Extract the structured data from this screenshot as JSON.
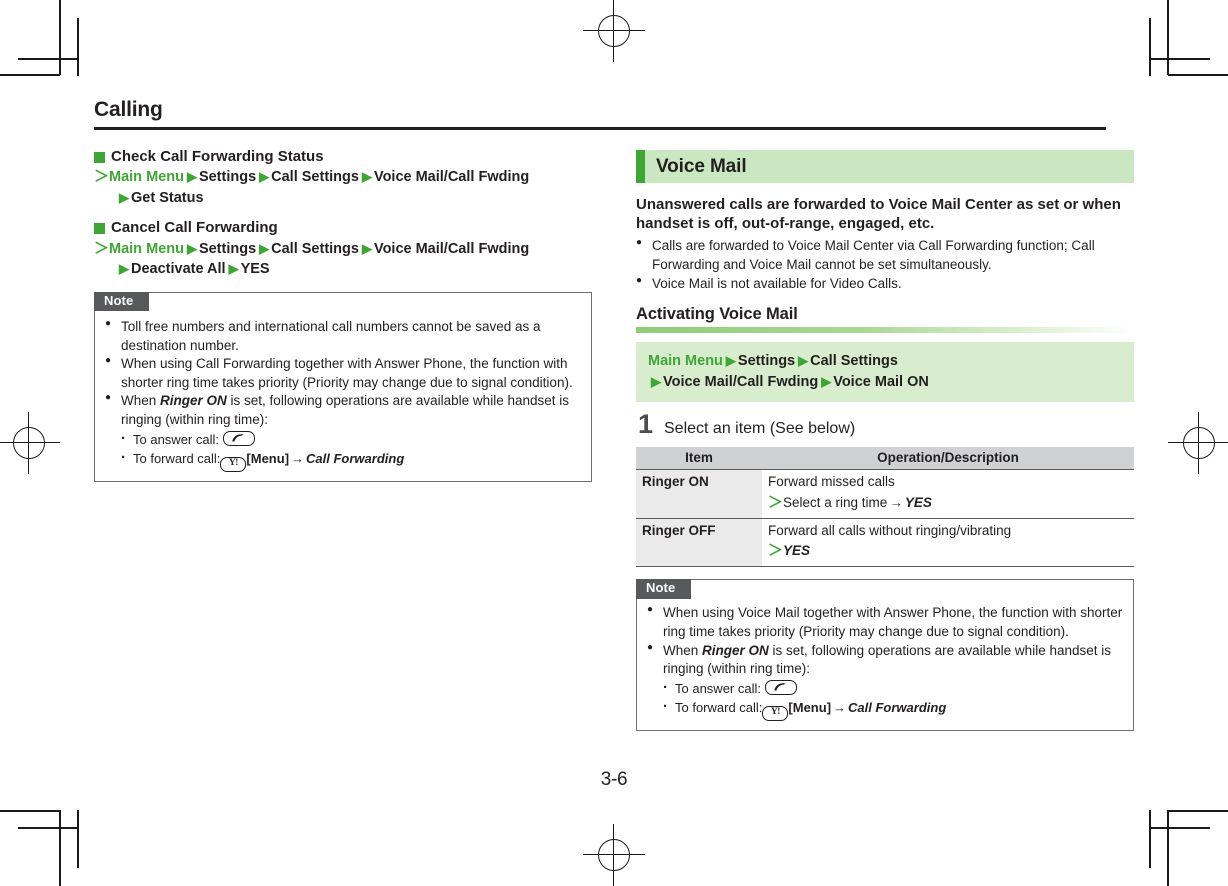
{
  "page": {
    "chapter_title": "Calling",
    "page_number": "3-6"
  },
  "left_column": {
    "sections": [
      {
        "heading": "Check Call Forwarding Status",
        "path_line1": [
          "Main Menu",
          "Settings",
          "Call Settings",
          "Voice Mail/Call Fwding"
        ],
        "path_line2": [
          "Get Status"
        ]
      },
      {
        "heading": "Cancel Call Forwarding",
        "path_line1": [
          "Main Menu",
          "Settings",
          "Call Settings",
          "Voice Mail/Call Fwding"
        ],
        "path_line2": [
          "Deactivate All",
          "YES"
        ]
      }
    ],
    "note": {
      "label": "Note",
      "bullets": [
        "Toll free numbers and international call numbers cannot be saved as a destination number.",
        "When using Call Forwarding together with Answer Phone, the function with shorter ring time takes priority (Priority may change due to signal condition)."
      ],
      "ringer_bullet": {
        "prefix": "When ",
        "emphasis": "Ringer ON",
        "suffix": " is set, following operations are available while handset is ringing (within ring time):"
      },
      "sub_items": [
        {
          "label": "To answer call:",
          "key": "call-key"
        },
        {
          "label": "To forward call:",
          "key": "yahoo-key",
          "key_label": "[Menu]",
          "arrow": "→",
          "target": "Call Forwarding"
        }
      ]
    }
  },
  "right_column": {
    "banner_title": "Voice Mail",
    "lead": "Unanswered calls are forwarded to Voice Mail Center as set or when handset is off, out-of-range, engaged, etc.",
    "bullets": [
      "Calls are forwarded to Voice Mail Center via Call Forwarding function; Call Forwarding and Voice Mail cannot be set simultaneously.",
      "Voice Mail is not available for Video Calls."
    ],
    "subsection_title": "Activating Voice Mail",
    "operation_path": {
      "line1": [
        "Main Menu",
        "Settings",
        "Call Settings"
      ],
      "line2": [
        "Voice Mail/Call Fwding",
        "Voice Mail ON"
      ]
    },
    "step": {
      "number": "1",
      "text": "Select an item (See below)"
    },
    "table": {
      "headers": [
        "Item",
        "Operation/Description"
      ],
      "rows": [
        {
          "item": "Ringer ON",
          "desc_line1": "Forward missed calls",
          "desc_line2_prefix": "Select a ring time",
          "desc_line2_arrow": "→",
          "desc_line2_target": "YES"
        },
        {
          "item": "Ringer OFF",
          "desc_line1": "Forward all calls without ringing/vibrating",
          "desc_line2_prefix": "",
          "desc_line2_arrow": "",
          "desc_line2_target": "YES"
        }
      ]
    },
    "note": {
      "label": "Note",
      "bullets": [
        "When using Voice Mail together with Answer Phone, the function with shorter ring time takes priority (Priority may change due to signal condition)."
      ],
      "ringer_bullet": {
        "prefix": "When ",
        "emphasis": "Ringer ON",
        "suffix": " is set, following operations are available while handset is ringing (within ring time):"
      },
      "sub_items": [
        {
          "label": "To answer call:",
          "key": "call-key"
        },
        {
          "label": "To forward call:",
          "key": "yahoo-key",
          "key_label": "[Menu]",
          "arrow": "→",
          "target": "Call Forwarding"
        }
      ]
    }
  },
  "glyphs": {
    "triangle": "▶",
    "gt": "＞",
    "yahoo_key_text": "Y!"
  },
  "colors": {
    "green_accent": "#3FA535",
    "green_banner_bg": "#C9E7C0",
    "green_op_bg": "#D7EDCD",
    "note_tab": "#58595B",
    "table_header": "#D0D1D3",
    "table_item_cell": "#EAEAEB",
    "text": "#231F20"
  }
}
